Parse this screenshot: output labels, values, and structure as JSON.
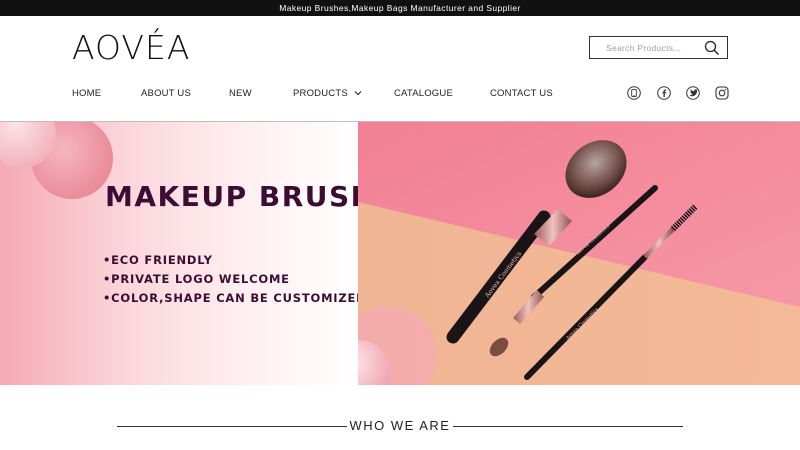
{
  "topbar": {
    "text": "Makeup Brushes,Makeup Bags Manufacturer and Supplier"
  },
  "header": {
    "logo": "AOVÉA",
    "search": {
      "placeholder": "Search Products..."
    }
  },
  "nav": {
    "items": [
      {
        "label": "HOME"
      },
      {
        "label": "ABOUT US"
      },
      {
        "label": "NEW"
      },
      {
        "label": "PRODUCTS",
        "has_dropdown": true
      },
      {
        "label": "CATALOGUE"
      },
      {
        "label": "CONTACT US"
      }
    ]
  },
  "social": [
    "phone-icon",
    "facebook-icon",
    "twitter-icon",
    "instagram-icon"
  ],
  "hero": {
    "title": "MAKEUP BRUSH",
    "features": [
      "•ECO FRIENDLY",
      "•PRIVATE LOGO WELCOME",
      "•COLOR,SHAPE CAN BE CUSTOMIZED"
    ],
    "brush_imprint": "Aovea Cosmetics"
  },
  "section": {
    "title": "WHO WE ARE"
  },
  "colors": {
    "topbar_bg": "#111111",
    "accent_dark_purple": "#3b0d33",
    "hero_pink": "#f28a9a",
    "hero_peach": "#efb48e"
  }
}
